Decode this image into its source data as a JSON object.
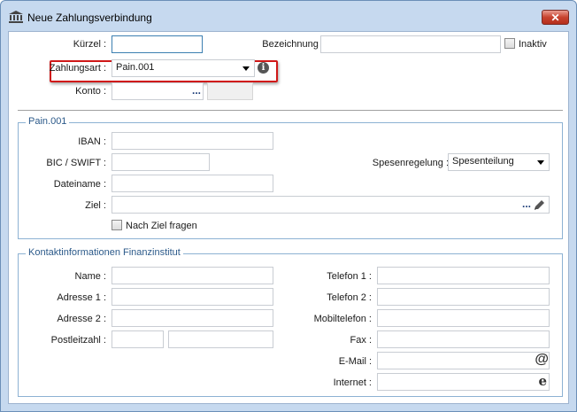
{
  "window": {
    "title": "Neue Zahlungsverbindung",
    "close_label": "✕"
  },
  "top": {
    "kuerzel_label": "Kürzel :",
    "kuerzel_value": "",
    "bezeichnung_label": "Bezeichnung :",
    "bezeichnung_value": "",
    "inaktiv_label": "Inaktiv",
    "zahlungsart_label": "Zahlungsart :",
    "zahlungsart_value": "Pain.001",
    "konto_label": "Konto :",
    "konto_value": "",
    "browse": "..."
  },
  "pain": {
    "group_title": "Pain.001",
    "iban_label": "IBAN :",
    "bic_label": "BIC / SWIFT :",
    "spesen_label": "Spesenregelung :",
    "spesen_value": "Spesenteilung",
    "dateiname_label": "Dateiname :",
    "ziel_label": "Ziel :",
    "nach_ziel_label": "Nach Ziel fragen"
  },
  "kontakt": {
    "group_title": "Kontaktinformationen Finanzinstitut",
    "name_label": "Name :",
    "adresse1_label": "Adresse 1 :",
    "adresse2_label": "Adresse 2 :",
    "plz_label": "Postleitzahl :",
    "telefon1_label": "Telefon 1 :",
    "telefon2_label": "Telefon 2 :",
    "mobil_label": "Mobiltelefon :",
    "fax_label": "Fax :",
    "email_label": "E-Mail :",
    "internet_label": "Internet :"
  },
  "icons": {
    "info": "info-icon",
    "at": "at-icon",
    "browser": "internet-explorer-icon",
    "edit": "pencil-icon",
    "bank": "bank-icon"
  }
}
